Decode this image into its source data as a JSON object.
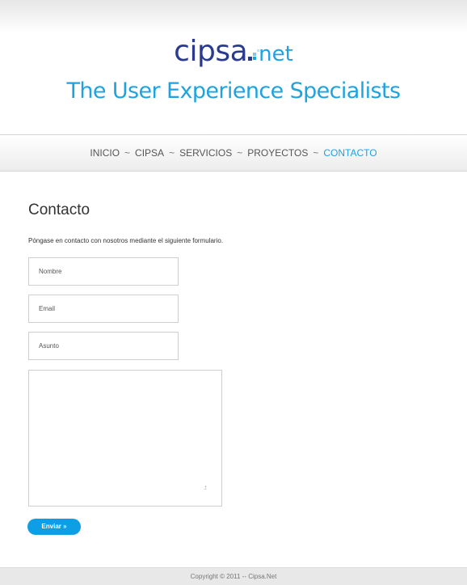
{
  "header": {
    "logo_main": "cipsa",
    "logo_net": "net",
    "tagline": "The User Experience Specialists",
    "colors": {
      "brand_dark": "#2a3b8f",
      "brand_light": "#1ea3e0"
    }
  },
  "nav": {
    "separator": "~",
    "items": [
      {
        "label": "INICIO",
        "active": false
      },
      {
        "label": "CIPSA",
        "active": false
      },
      {
        "label": "SERVICIOS",
        "active": false
      },
      {
        "label": "PROYECTOS",
        "active": false
      },
      {
        "label": "CONTACTO",
        "active": true
      }
    ]
  },
  "main": {
    "title": "Contacto",
    "intro": "Póngase en contacto con nosotros mediante el siguiente formulario.",
    "form": {
      "name_placeholder": "Nombre",
      "email_placeholder": "Email",
      "subject_placeholder": "Asunto",
      "message_value": "",
      "resize_grip": ".:!",
      "submit_label": "Enviar »"
    }
  },
  "footer": {
    "copyright": "Copyright © 2011 -- Cipsa.Net"
  },
  "colors": {
    "accent": "#1ea3e0",
    "button": "#0d9ee6"
  }
}
